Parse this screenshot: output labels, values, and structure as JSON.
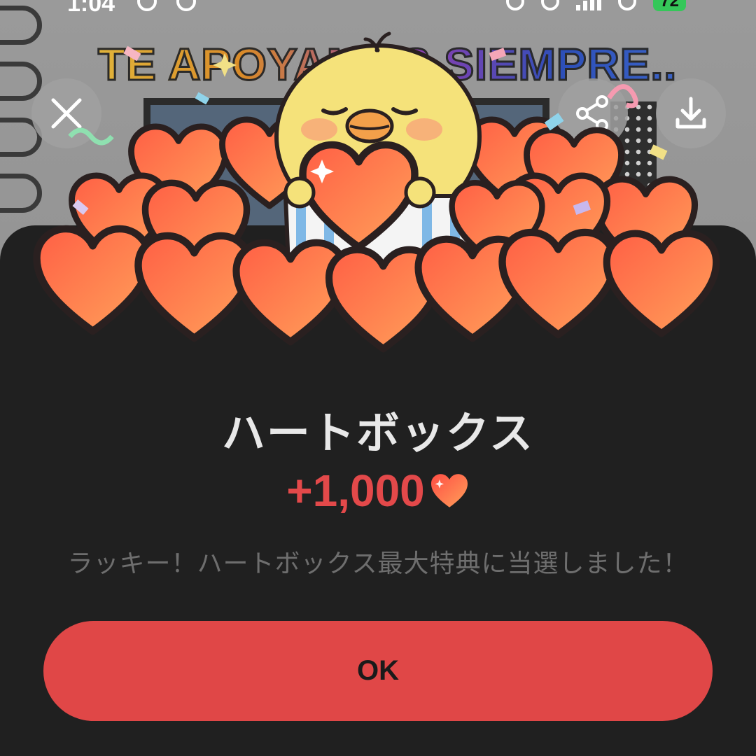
{
  "status_bar": {
    "time": "1:04",
    "battery": "72"
  },
  "banner_text": "TE APOYAMOS SIEMPRE..",
  "top_controls": {
    "close_icon": "close-icon",
    "share_icon": "share-icon",
    "download_icon": "download-icon"
  },
  "dialog": {
    "title": "ハートボックス",
    "amount": "+1,000",
    "amount_icon": "heart-icon",
    "message": "ラッキー！ハートボックス最大特典に当選しました！",
    "ok_label": "OK"
  },
  "colors": {
    "sheet_bg": "#202020",
    "accent_red": "#e04747",
    "amount_red": "#e3494a",
    "title": "#e8e8e8",
    "message": "#6e6e6e"
  }
}
